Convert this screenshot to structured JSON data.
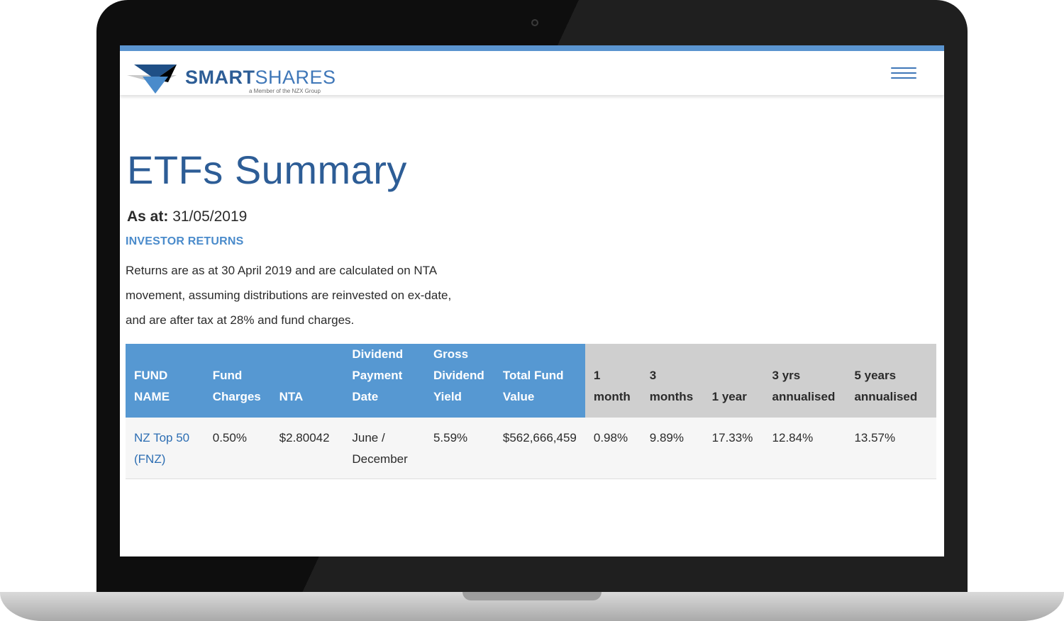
{
  "brand": {
    "name_bold": "SMART",
    "name_light": "SHARES",
    "tagline": "a Member of the NZX Group",
    "colors": {
      "accent": "#5698d2",
      "dark_blue": "#2d5d96",
      "header_grey": "#cfcfcf"
    }
  },
  "header": {
    "menu_icon": "hamburger-menu-icon"
  },
  "page": {
    "title": "ETFs Summary",
    "as_at_label": "As at:",
    "as_at_date": "31/05/2019",
    "section_label": "INVESTOR RETURNS",
    "description": "Returns are as at 30 April 2019 and are calculated on NTA movement, assuming distributions are reinvested on ex-date, and are after tax at 28% and fund charges."
  },
  "table": {
    "headers": [
      "FUND NAME",
      "Fund Charges",
      "NTA",
      "Dividend Payment Date",
      "Gross Dividend Yield",
      "Total Fund Value",
      "1 month",
      "3 months",
      "1 year",
      "3 yrs annualised",
      "5 years annualised"
    ],
    "rows": [
      {
        "fund_name": "NZ Top 50 (FNZ)",
        "fund_charges": "0.50%",
        "nta": "$2.80042",
        "dividend_payment_date": "June / December",
        "gross_dividend_yield": "5.59%",
        "total_fund_value": "$562,666,459",
        "one_month": "0.98%",
        "three_months": "9.89%",
        "one_year": "17.33%",
        "three_yrs_annualised": "12.84%",
        "five_years_annualised": "13.57%"
      }
    ]
  }
}
